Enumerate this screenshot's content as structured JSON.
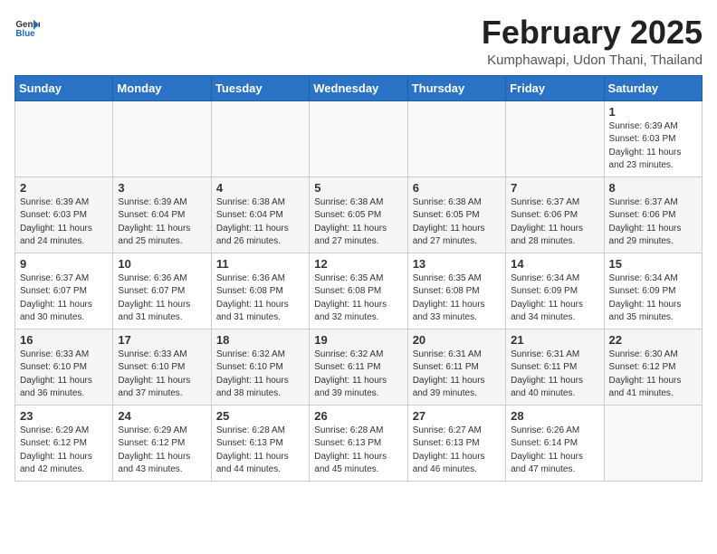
{
  "header": {
    "logo_general": "General",
    "logo_blue": "Blue",
    "month": "February 2025",
    "location": "Kumphawapi, Udon Thani, Thailand"
  },
  "weekdays": [
    "Sunday",
    "Monday",
    "Tuesday",
    "Wednesday",
    "Thursday",
    "Friday",
    "Saturday"
  ],
  "weeks": [
    [
      {
        "day": "",
        "info": ""
      },
      {
        "day": "",
        "info": ""
      },
      {
        "day": "",
        "info": ""
      },
      {
        "day": "",
        "info": ""
      },
      {
        "day": "",
        "info": ""
      },
      {
        "day": "",
        "info": ""
      },
      {
        "day": "1",
        "info": "Sunrise: 6:39 AM\nSunset: 6:03 PM\nDaylight: 11 hours\nand 23 minutes."
      }
    ],
    [
      {
        "day": "2",
        "info": "Sunrise: 6:39 AM\nSunset: 6:03 PM\nDaylight: 11 hours\nand 24 minutes."
      },
      {
        "day": "3",
        "info": "Sunrise: 6:39 AM\nSunset: 6:04 PM\nDaylight: 11 hours\nand 25 minutes."
      },
      {
        "day": "4",
        "info": "Sunrise: 6:38 AM\nSunset: 6:04 PM\nDaylight: 11 hours\nand 26 minutes."
      },
      {
        "day": "5",
        "info": "Sunrise: 6:38 AM\nSunset: 6:05 PM\nDaylight: 11 hours\nand 27 minutes."
      },
      {
        "day": "6",
        "info": "Sunrise: 6:38 AM\nSunset: 6:05 PM\nDaylight: 11 hours\nand 27 minutes."
      },
      {
        "day": "7",
        "info": "Sunrise: 6:37 AM\nSunset: 6:06 PM\nDaylight: 11 hours\nand 28 minutes."
      },
      {
        "day": "8",
        "info": "Sunrise: 6:37 AM\nSunset: 6:06 PM\nDaylight: 11 hours\nand 29 minutes."
      }
    ],
    [
      {
        "day": "9",
        "info": "Sunrise: 6:37 AM\nSunset: 6:07 PM\nDaylight: 11 hours\nand 30 minutes."
      },
      {
        "day": "10",
        "info": "Sunrise: 6:36 AM\nSunset: 6:07 PM\nDaylight: 11 hours\nand 31 minutes."
      },
      {
        "day": "11",
        "info": "Sunrise: 6:36 AM\nSunset: 6:08 PM\nDaylight: 11 hours\nand 31 minutes."
      },
      {
        "day": "12",
        "info": "Sunrise: 6:35 AM\nSunset: 6:08 PM\nDaylight: 11 hours\nand 32 minutes."
      },
      {
        "day": "13",
        "info": "Sunrise: 6:35 AM\nSunset: 6:08 PM\nDaylight: 11 hours\nand 33 minutes."
      },
      {
        "day": "14",
        "info": "Sunrise: 6:34 AM\nSunset: 6:09 PM\nDaylight: 11 hours\nand 34 minutes."
      },
      {
        "day": "15",
        "info": "Sunrise: 6:34 AM\nSunset: 6:09 PM\nDaylight: 11 hours\nand 35 minutes."
      }
    ],
    [
      {
        "day": "16",
        "info": "Sunrise: 6:33 AM\nSunset: 6:10 PM\nDaylight: 11 hours\nand 36 minutes."
      },
      {
        "day": "17",
        "info": "Sunrise: 6:33 AM\nSunset: 6:10 PM\nDaylight: 11 hours\nand 37 minutes."
      },
      {
        "day": "18",
        "info": "Sunrise: 6:32 AM\nSunset: 6:10 PM\nDaylight: 11 hours\nand 38 minutes."
      },
      {
        "day": "19",
        "info": "Sunrise: 6:32 AM\nSunset: 6:11 PM\nDaylight: 11 hours\nand 39 minutes."
      },
      {
        "day": "20",
        "info": "Sunrise: 6:31 AM\nSunset: 6:11 PM\nDaylight: 11 hours\nand 39 minutes."
      },
      {
        "day": "21",
        "info": "Sunrise: 6:31 AM\nSunset: 6:11 PM\nDaylight: 11 hours\nand 40 minutes."
      },
      {
        "day": "22",
        "info": "Sunrise: 6:30 AM\nSunset: 6:12 PM\nDaylight: 11 hours\nand 41 minutes."
      }
    ],
    [
      {
        "day": "23",
        "info": "Sunrise: 6:29 AM\nSunset: 6:12 PM\nDaylight: 11 hours\nand 42 minutes."
      },
      {
        "day": "24",
        "info": "Sunrise: 6:29 AM\nSunset: 6:12 PM\nDaylight: 11 hours\nand 43 minutes."
      },
      {
        "day": "25",
        "info": "Sunrise: 6:28 AM\nSunset: 6:13 PM\nDaylight: 11 hours\nand 44 minutes."
      },
      {
        "day": "26",
        "info": "Sunrise: 6:28 AM\nSunset: 6:13 PM\nDaylight: 11 hours\nand 45 minutes."
      },
      {
        "day": "27",
        "info": "Sunrise: 6:27 AM\nSunset: 6:13 PM\nDaylight: 11 hours\nand 46 minutes."
      },
      {
        "day": "28",
        "info": "Sunrise: 6:26 AM\nSunset: 6:14 PM\nDaylight: 11 hours\nand 47 minutes."
      },
      {
        "day": "",
        "info": ""
      }
    ]
  ]
}
